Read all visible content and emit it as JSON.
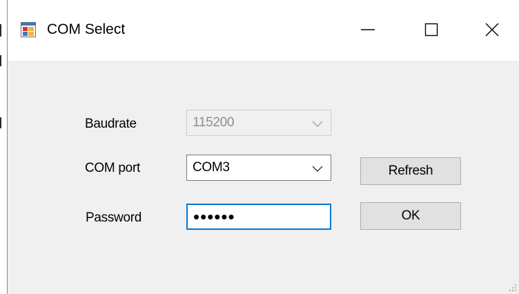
{
  "window": {
    "title": "COM Select",
    "app_icon": "windows-form-icon",
    "controls": {
      "minimize_icon": "minimize-icon",
      "maximize_icon": "maximize-icon",
      "close_icon": "close-icon"
    }
  },
  "form": {
    "baudrate": {
      "label": "Baudrate",
      "value": "115200",
      "enabled": false
    },
    "com_port": {
      "label": "COM port",
      "value": "COM3"
    },
    "password": {
      "label": "Password",
      "value": "••••••"
    }
  },
  "buttons": {
    "refresh_label": "Refresh",
    "ok_label": "OK"
  },
  "colors": {
    "focus_border": "#0078d7",
    "window_bg": "#f0f0f0",
    "button_bg": "#e1e1e1",
    "disabled_text": "#8d8d8d"
  }
}
